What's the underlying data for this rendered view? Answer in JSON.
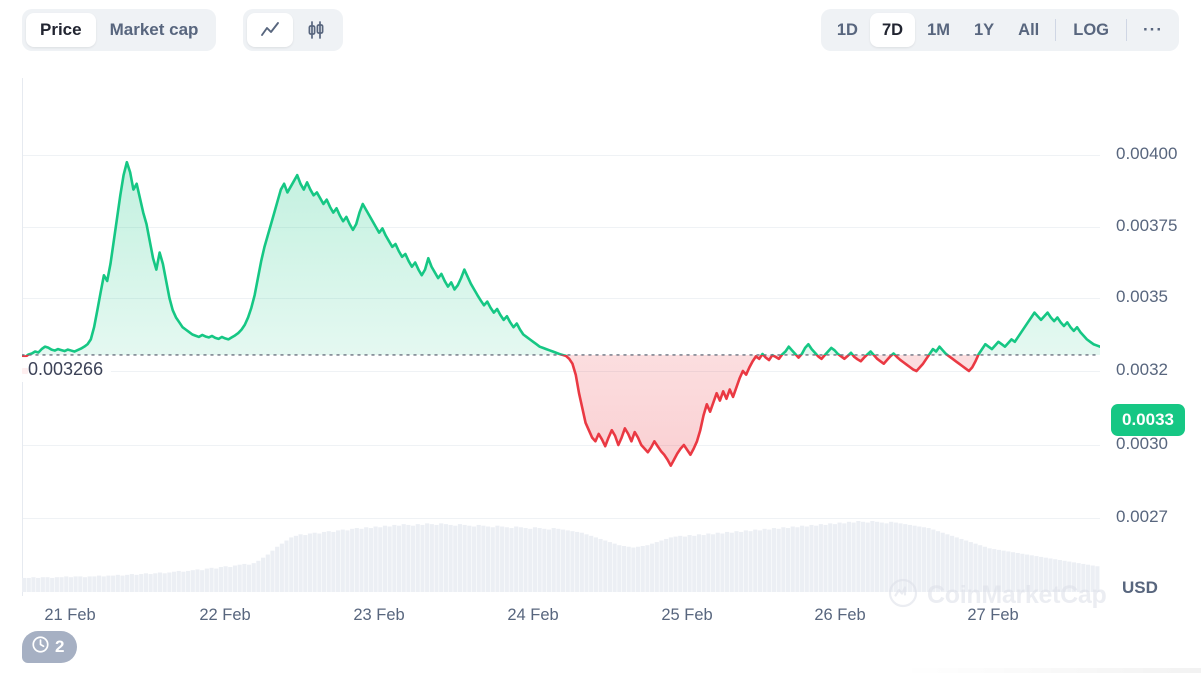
{
  "toolbar": {
    "metric_tabs": [
      {
        "label": "Price",
        "active": true
      },
      {
        "label": "Market cap",
        "active": false
      }
    ],
    "chart_kind": [
      {
        "icon": "line-chart-icon",
        "active": true
      },
      {
        "icon": "candlestick-chart-icon",
        "active": false
      }
    ],
    "ranges": [
      {
        "label": "1D",
        "active": false
      },
      {
        "label": "7D",
        "active": true
      },
      {
        "label": "1M",
        "active": false
      },
      {
        "label": "1Y",
        "active": false
      },
      {
        "label": "All",
        "active": false
      }
    ],
    "log_label": "LOG",
    "more_label": "···"
  },
  "history_badge": {
    "count": "2",
    "icon": "clock-history-icon"
  },
  "watermark": {
    "text": "CoinMarketCap",
    "icon": "coinmarketcap-logo-icon"
  },
  "current_price_badge": "0.0033",
  "reference_price_label": "0.003266",
  "currency_unit": "USD",
  "colors": {
    "up": "#16c784",
    "down": "#ea3943",
    "axis_text": "#58667e",
    "grid": "#eff2f5",
    "toolbar_bg": "#eff2f5",
    "volume": "#eceff4"
  },
  "chart_data": {
    "type": "line",
    "title": "",
    "xlabel": "",
    "ylabel": "USD",
    "grid": true,
    "legend": "none",
    "currency": "USD",
    "reference_price": 0.003266,
    "last_price": 0.0033,
    "y_ticks": [
      {
        "label": "0.00400",
        "value": 0.004
      },
      {
        "label": "0.00375",
        "value": 0.00375
      },
      {
        "label": "0.0035",
        "value": 0.0035
      },
      {
        "label": "0.0032",
        "value": 0.0032
      },
      {
        "label": "0.0030",
        "value": 0.003
      },
      {
        "label": "0.0027",
        "value": 0.0027
      }
    ],
    "x_ticks": [
      "21 Feb",
      "22 Feb",
      "23 Feb",
      "24 Feb",
      "25 Feb",
      "26 Feb",
      "27 Feb"
    ],
    "ylim": [
      0.00262,
      0.00408
    ],
    "series": [
      {
        "name": "Price",
        "values": [
          0.003262,
          0.003258,
          0.003268,
          0.003272,
          0.00328,
          0.003276,
          0.00329,
          0.0033,
          0.003296,
          0.003288,
          0.003284,
          0.00329,
          0.003286,
          0.003282,
          0.003288,
          0.003284,
          0.00328,
          0.003286,
          0.003292,
          0.0033,
          0.00331,
          0.00333,
          0.00338,
          0.00345,
          0.00352,
          0.00358,
          0.00356,
          0.00362,
          0.0037,
          0.00378,
          0.00386,
          0.00393,
          0.003975,
          0.00394,
          0.00388,
          0.0039,
          0.00385,
          0.0038,
          0.00376,
          0.0037,
          0.00364,
          0.0036,
          0.00366,
          0.00362,
          0.00356,
          0.0035,
          0.00345,
          0.00342,
          0.0034,
          0.00338,
          0.00337,
          0.00336,
          0.00335,
          0.003345,
          0.00334,
          0.003348,
          0.003342,
          0.003338,
          0.003344,
          0.003336,
          0.003332,
          0.00334,
          0.003334,
          0.00333,
          0.003338,
          0.003346,
          0.003356,
          0.00337,
          0.00339,
          0.00342,
          0.00346,
          0.00351,
          0.00357,
          0.00363,
          0.00368,
          0.00372,
          0.00376,
          0.0038,
          0.00384,
          0.00388,
          0.0039,
          0.00387,
          0.00389,
          0.00391,
          0.00393,
          0.0039,
          0.00388,
          0.003905,
          0.00388,
          0.00386,
          0.00387,
          0.00385,
          0.00383,
          0.003845,
          0.00382,
          0.0038,
          0.003815,
          0.00379,
          0.00377,
          0.003785,
          0.00376,
          0.00374,
          0.00376,
          0.0038,
          0.00383,
          0.00381,
          0.00379,
          0.00377,
          0.00375,
          0.00373,
          0.003745,
          0.00372,
          0.0037,
          0.00368,
          0.00369,
          0.003665,
          0.003645,
          0.003655,
          0.00363,
          0.00361,
          0.003625,
          0.0036,
          0.00358,
          0.0036,
          0.00364,
          0.00361,
          0.00359,
          0.00357,
          0.003585,
          0.00356,
          0.00354,
          0.003555,
          0.00353,
          0.003545,
          0.00357,
          0.0036,
          0.003575,
          0.00355,
          0.00353,
          0.00351,
          0.00349,
          0.00347,
          0.003485,
          0.00346,
          0.00344,
          0.003455,
          0.00343,
          0.00341,
          0.003425,
          0.0034,
          0.00338,
          0.003395,
          0.00337,
          0.00335,
          0.00334,
          0.00333,
          0.00332,
          0.00331,
          0.0033,
          0.003295,
          0.00329,
          0.003285,
          0.00328,
          0.003275,
          0.00327,
          0.003266,
          0.003262,
          0.00325,
          0.00323,
          0.00319,
          0.00314,
          0.0031,
          0.00306,
          0.00304,
          0.00302,
          0.00301,
          0.00303,
          0.003015,
          0.002995,
          0.00302,
          0.00304,
          0.003025,
          0.003,
          0.00302,
          0.003045,
          0.00303,
          0.00301,
          0.003035,
          0.00302,
          0.003,
          0.002985,
          0.00297,
          0.00299,
          0.00301,
          0.002995,
          0.002975,
          0.00296,
          0.00294,
          0.002915,
          0.00294,
          0.002965,
          0.002985,
          0.003,
          0.00298,
          0.00296,
          0.002985,
          0.00301,
          0.00304,
          0.00308,
          0.00311,
          0.00309,
          0.003115,
          0.00314,
          0.00312,
          0.003145,
          0.003125,
          0.00315,
          0.00313,
          0.003155,
          0.00318,
          0.0032,
          0.00319,
          0.003215,
          0.00324,
          0.00326,
          0.00325,
          0.00327,
          0.003255,
          0.003245,
          0.003265,
          0.003258,
          0.00325,
          0.003268,
          0.00328,
          0.0033,
          0.003285,
          0.00327,
          0.003255,
          0.00327,
          0.003295,
          0.00331,
          0.00329,
          0.003275,
          0.00326,
          0.00325,
          0.003265,
          0.00328,
          0.003295,
          0.003285,
          0.00327,
          0.00326,
          0.00325,
          0.003262,
          0.003275,
          0.003258,
          0.003248,
          0.00324,
          0.003255,
          0.003268,
          0.00328,
          0.003265,
          0.00325,
          0.00324,
          0.00323,
          0.003245,
          0.00326,
          0.003272,
          0.003258,
          0.003246,
          0.003236,
          0.003226,
          0.003216,
          0.003206,
          0.0032,
          0.003215,
          0.00323,
          0.00325,
          0.00327,
          0.00329,
          0.00328,
          0.0033,
          0.003285,
          0.00327,
          0.00326,
          0.00325,
          0.00324,
          0.00323,
          0.00322,
          0.00321,
          0.0032,
          0.003215,
          0.00324,
          0.00327,
          0.00329,
          0.00331,
          0.0033,
          0.00329,
          0.003305,
          0.00332,
          0.00331,
          0.0033,
          0.003315,
          0.00333,
          0.00332,
          0.00334,
          0.00336,
          0.00338,
          0.0034,
          0.00342,
          0.00344,
          0.003425,
          0.00341,
          0.003425,
          0.00344,
          0.00342,
          0.003405,
          0.00342,
          0.0034,
          0.003385,
          0.0034,
          0.00338,
          0.003365,
          0.00338,
          0.00336,
          0.003345,
          0.00333,
          0.00332,
          0.00331,
          0.003305,
          0.0033
        ]
      }
    ],
    "volume_series": {
      "name": "Volume",
      "values": [
        0.18,
        0.18,
        0.19,
        0.18,
        0.19,
        0.19,
        0.18,
        0.19,
        0.19,
        0.2,
        0.19,
        0.2,
        0.2,
        0.19,
        0.2,
        0.2,
        0.21,
        0.2,
        0.21,
        0.21,
        0.22,
        0.21,
        0.22,
        0.23,
        0.22,
        0.23,
        0.24,
        0.23,
        0.24,
        0.25,
        0.24,
        0.25,
        0.26,
        0.27,
        0.26,
        0.27,
        0.28,
        0.29,
        0.28,
        0.3,
        0.31,
        0.3,
        0.32,
        0.33,
        0.32,
        0.34,
        0.35,
        0.36,
        0.35,
        0.37,
        0.4,
        0.44,
        0.48,
        0.53,
        0.58,
        0.62,
        0.66,
        0.7,
        0.72,
        0.74,
        0.73,
        0.75,
        0.76,
        0.75,
        0.77,
        0.78,
        0.77,
        0.79,
        0.8,
        0.79,
        0.81,
        0.82,
        0.81,
        0.83,
        0.82,
        0.84,
        0.83,
        0.85,
        0.84,
        0.86,
        0.85,
        0.87,
        0.86,
        0.85,
        0.87,
        0.86,
        0.88,
        0.87,
        0.86,
        0.88,
        0.87,
        0.86,
        0.85,
        0.87,
        0.86,
        0.85,
        0.84,
        0.86,
        0.85,
        0.84,
        0.83,
        0.85,
        0.84,
        0.83,
        0.82,
        0.84,
        0.83,
        0.82,
        0.81,
        0.83,
        0.82,
        0.81,
        0.8,
        0.82,
        0.81,
        0.8,
        0.79,
        0.78,
        0.77,
        0.76,
        0.74,
        0.72,
        0.7,
        0.68,
        0.66,
        0.64,
        0.62,
        0.6,
        0.59,
        0.58,
        0.57,
        0.58,
        0.59,
        0.6,
        0.62,
        0.64,
        0.66,
        0.68,
        0.7,
        0.71,
        0.72,
        0.71,
        0.73,
        0.72,
        0.74,
        0.73,
        0.75,
        0.74,
        0.76,
        0.75,
        0.77,
        0.76,
        0.78,
        0.77,
        0.79,
        0.78,
        0.8,
        0.79,
        0.81,
        0.8,
        0.82,
        0.81,
        0.83,
        0.82,
        0.84,
        0.83,
        0.85,
        0.84,
        0.86,
        0.85,
        0.87,
        0.86,
        0.88,
        0.87,
        0.89,
        0.88,
        0.9,
        0.89,
        0.91,
        0.9,
        0.89,
        0.91,
        0.9,
        0.89,
        0.88,
        0.9,
        0.89,
        0.88,
        0.87,
        0.86,
        0.85,
        0.84,
        0.83,
        0.82,
        0.8,
        0.78,
        0.76,
        0.74,
        0.72,
        0.7,
        0.68,
        0.66,
        0.64,
        0.62,
        0.6,
        0.58,
        0.56,
        0.55,
        0.54,
        0.53,
        0.52,
        0.51,
        0.5,
        0.49,
        0.48,
        0.47,
        0.46,
        0.45,
        0.44,
        0.43,
        0.42,
        0.41,
        0.4,
        0.39,
        0.38,
        0.37,
        0.36,
        0.35,
        0.34,
        0.33
      ]
    }
  }
}
